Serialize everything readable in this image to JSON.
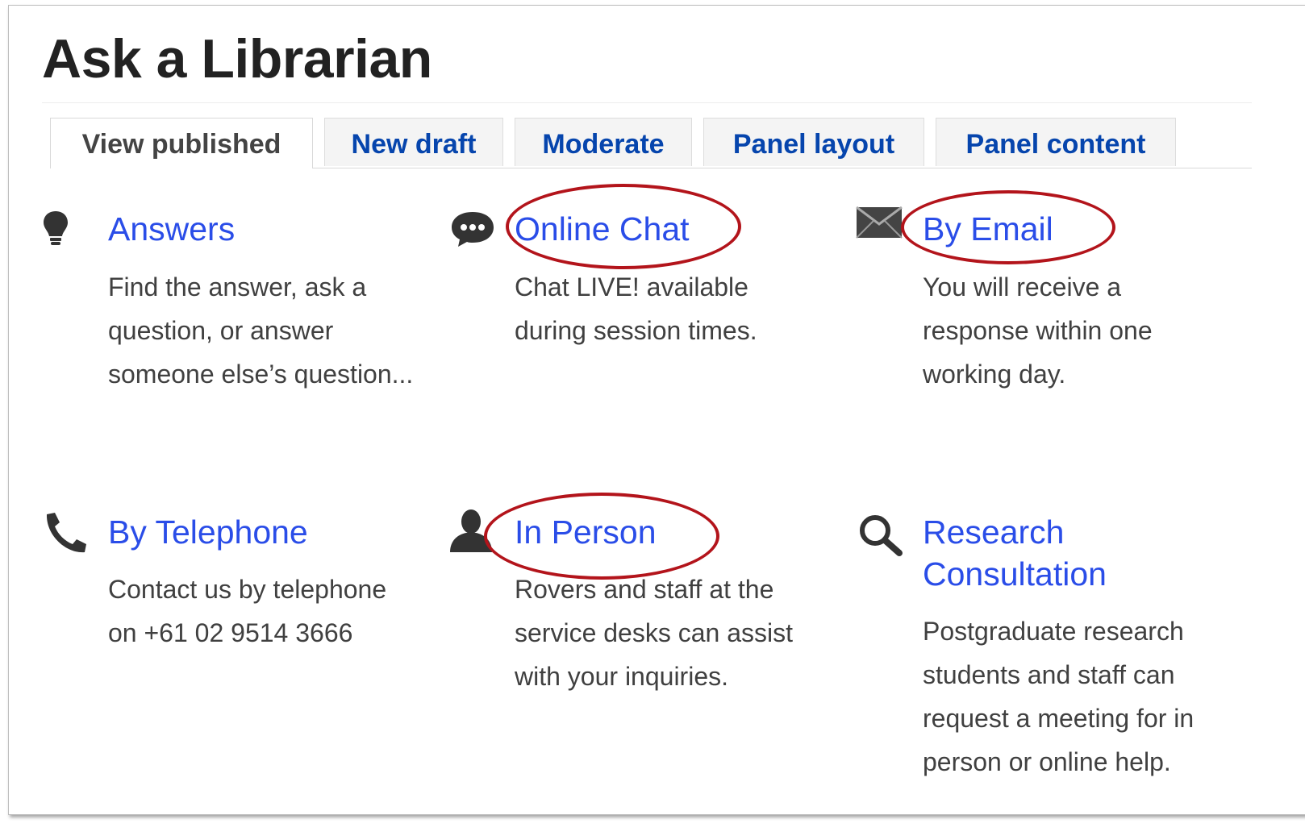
{
  "page": {
    "title": "Ask a Librarian"
  },
  "tabs": [
    {
      "label": "View published",
      "active": true
    },
    {
      "label": "New draft",
      "active": false
    },
    {
      "label": "Moderate",
      "active": false
    },
    {
      "label": "Panel layout",
      "active": false
    },
    {
      "label": "Panel content",
      "active": false
    }
  ],
  "items": [
    {
      "icon": "lightbulb-icon",
      "title": "Answers",
      "description": "Find the answer, ask a question, or answer someone else’s question...",
      "highlighted": false
    },
    {
      "icon": "chat-bubble-icon",
      "title": "Online Chat",
      "description": "Chat LIVE! available during session times.",
      "highlighted": true
    },
    {
      "icon": "envelope-icon",
      "title": "By Email",
      "description": "You will receive a response within one working day.",
      "highlighted": true
    },
    {
      "icon": "telephone-icon",
      "title": "By Telephone",
      "description": "Contact us by telephone on +61 02 9514 3666",
      "highlighted": false
    },
    {
      "icon": "person-icon",
      "title": "In Person",
      "description": "Rovers and staff at the service desks can assist with your inquiries.",
      "highlighted": true
    },
    {
      "icon": "magnifier-icon",
      "title": "Research Consultation",
      "description": "Postgraduate research students and staff can request a meeting for in person or online help.",
      "highlighted": false
    }
  ],
  "colors": {
    "link": "#2a4de8",
    "tab_link": "#0645ad",
    "highlight_ring": "#b3141b",
    "body_text": "#404040"
  }
}
